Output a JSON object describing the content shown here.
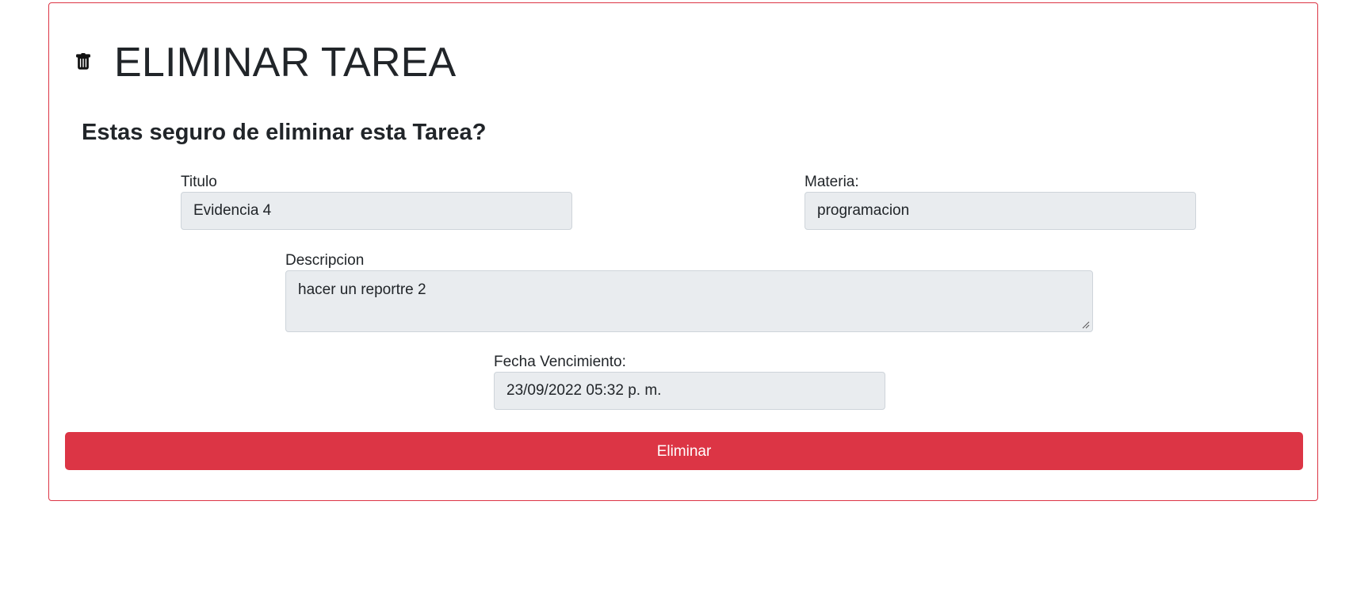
{
  "page": {
    "title": "ELIMINAR TAREA",
    "icon": "trash-icon",
    "question": "Estas seguro de eliminar esta Tarea?"
  },
  "form": {
    "titulo": {
      "label": "Titulo",
      "value": "Evidencia 4"
    },
    "materia": {
      "label": "Materia:",
      "value": "programacion"
    },
    "descripcion": {
      "label": "Descripcion",
      "value": "hacer un reportre 2"
    },
    "fecha_vencimiento": {
      "label": "Fecha Vencimiento:",
      "value": "23/09/2022 05:32  p. m."
    }
  },
  "actions": {
    "delete_label": "Eliminar"
  },
  "colors": {
    "danger": "#dc3545",
    "input_bg": "#e9ecef",
    "input_border": "#ced4da",
    "text": "#212529"
  }
}
